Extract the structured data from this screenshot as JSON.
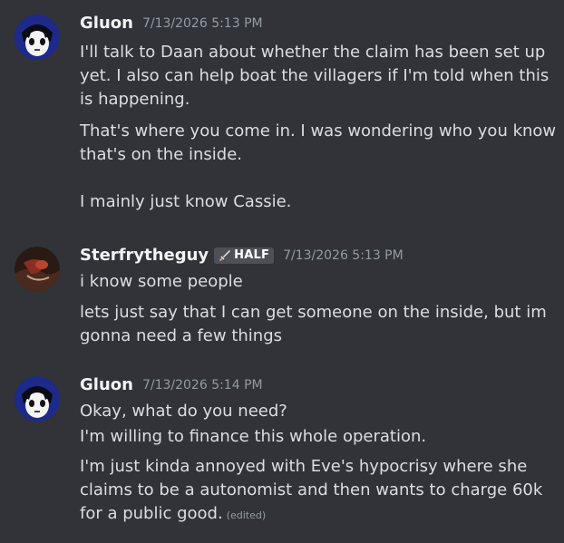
{
  "messages": [
    {
      "username": "Gluon",
      "timestamp": "7/13/2026 5:13 PM",
      "lines": [
        "I'll talk to Daan about whether the claim has been set up yet. I also can help boat the villagers if I'm told when this is happening.",
        "That's where you come in. I was wondering who you know that's on the inside.\n\nI mainly just know Cassie."
      ]
    },
    {
      "username": "Sterfrytheguy",
      "tag": "HALF",
      "tag_icon": "sword-icon",
      "timestamp": "7/13/2026 5:13 PM",
      "lines": [
        "i know some people",
        "lets just say that I can get someone on the inside, but im gonna need a few things"
      ]
    },
    {
      "username": "Gluon",
      "timestamp": "7/13/2026 5:14 PM",
      "lines": [
        "Okay, what do you need?",
        "I'm willing to finance this whole operation.",
        "I'm just kinda annoyed with Eve's hypocrisy where she claims to be a autonomist and then wants to charge 60k for a public good."
      ],
      "edited_label": "(edited)"
    }
  ]
}
